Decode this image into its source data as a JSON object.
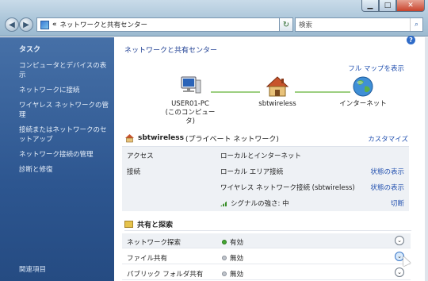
{
  "toolbar": {
    "address_sep": "«",
    "address_text": "ネットワークと共有センター",
    "search_label": "検索"
  },
  "left": {
    "tasks_title": "タスク",
    "tasks": [
      "コンピュータとデバイスの表示",
      "ネットワークに接続",
      "ワイヤレス ネットワークの管理",
      "接続またはネットワークのセットアップ",
      "ネットワーク接続の管理",
      "診断と修復"
    ],
    "related": "関連項目"
  },
  "main": {
    "title": "ネットワークと共有センター",
    "full_map": "フル マップを表示",
    "nodes": {
      "pc_name": "USER01-PC",
      "pc_sub": "(このコンピュータ)",
      "router": "sbtwireless",
      "internet": "インターネット"
    },
    "network": {
      "name": "sbtwireless",
      "type": "(プライベート ネットワーク)",
      "customize": "カスタマイズ"
    },
    "details": {
      "access_label": "アクセス",
      "access_value": "ローカルとインターネット",
      "connection_label": "接続",
      "conn1": "ローカル エリア接続",
      "conn1_link": "状態の表示",
      "conn2": "ワイヤレス ネットワーク接続 (sbtwireless)",
      "conn2_link": "状態の表示",
      "signal": "シグナルの強さ: 中",
      "signal_link": "切断"
    },
    "sharing": {
      "title": "共有と探索",
      "rows": [
        {
          "name": "ネットワーク探索",
          "status": "有効",
          "on": true
        },
        {
          "name": "ファイル共有",
          "status": "無効",
          "on": false
        },
        {
          "name": "パブリック フォルダ共有",
          "status": "無効",
          "on": false
        }
      ]
    }
  },
  "colors": {
    "left_pane": "#2d5690",
    "link": "#2452b0",
    "title": "#1e3f93",
    "on": "#44a632"
  }
}
